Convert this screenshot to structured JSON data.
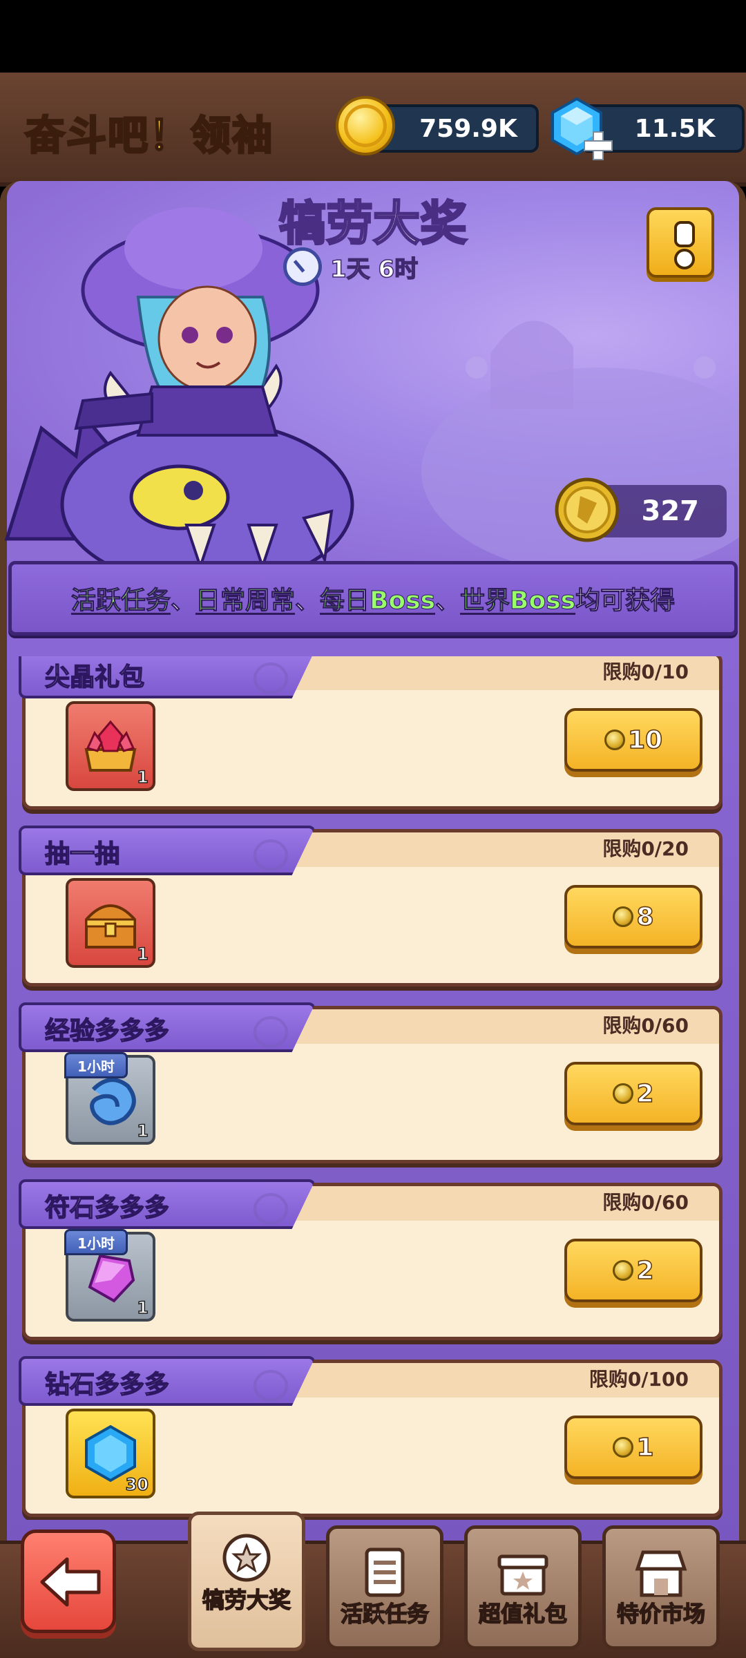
{
  "header": {
    "game_title": "奋斗吧！领袖",
    "coins": "759.9K",
    "gems": "11.5K"
  },
  "event": {
    "title": "犒劳大奖",
    "timer": "1天 6时",
    "tokens": "327"
  },
  "notice": {
    "links": [
      "活跃任务",
      "日常周常",
      "每日Boss",
      "世界Boss"
    ],
    "separator": "、",
    "suffix": "均可获得"
  },
  "shop": {
    "items": [
      {
        "name": "尖晶礼包",
        "limit": "限购0/10",
        "count": "1",
        "price": "10",
        "icon": "crystal-chest-icon",
        "tag": ""
      },
      {
        "name": "抽一抽",
        "limit": "限购0/20",
        "count": "1",
        "price": "8",
        "icon": "treasure-chest-icon",
        "tag": ""
      },
      {
        "name": "经验多多多",
        "limit": "限购0/60",
        "count": "1",
        "price": "2",
        "icon": "exp-swirl-icon",
        "tag": "1小时"
      },
      {
        "name": "符石多多多",
        "limit": "限购0/60",
        "count": "1",
        "price": "2",
        "icon": "rune-crystal-icon",
        "tag": "1小时"
      },
      {
        "name": "钻石多多多",
        "limit": "限购0/100",
        "count": "30",
        "price": "1",
        "icon": "diamond-icon",
        "tag": ""
      }
    ]
  },
  "nav": {
    "tabs": [
      "犒劳大奖",
      "活跃任务",
      "超值礼包",
      "特价市场"
    ],
    "active": "犒劳大奖"
  },
  "colors": {
    "accent_gold": "#f4b326",
    "panel_purple": "#8a68d5",
    "link_green": "#99ff6a"
  }
}
